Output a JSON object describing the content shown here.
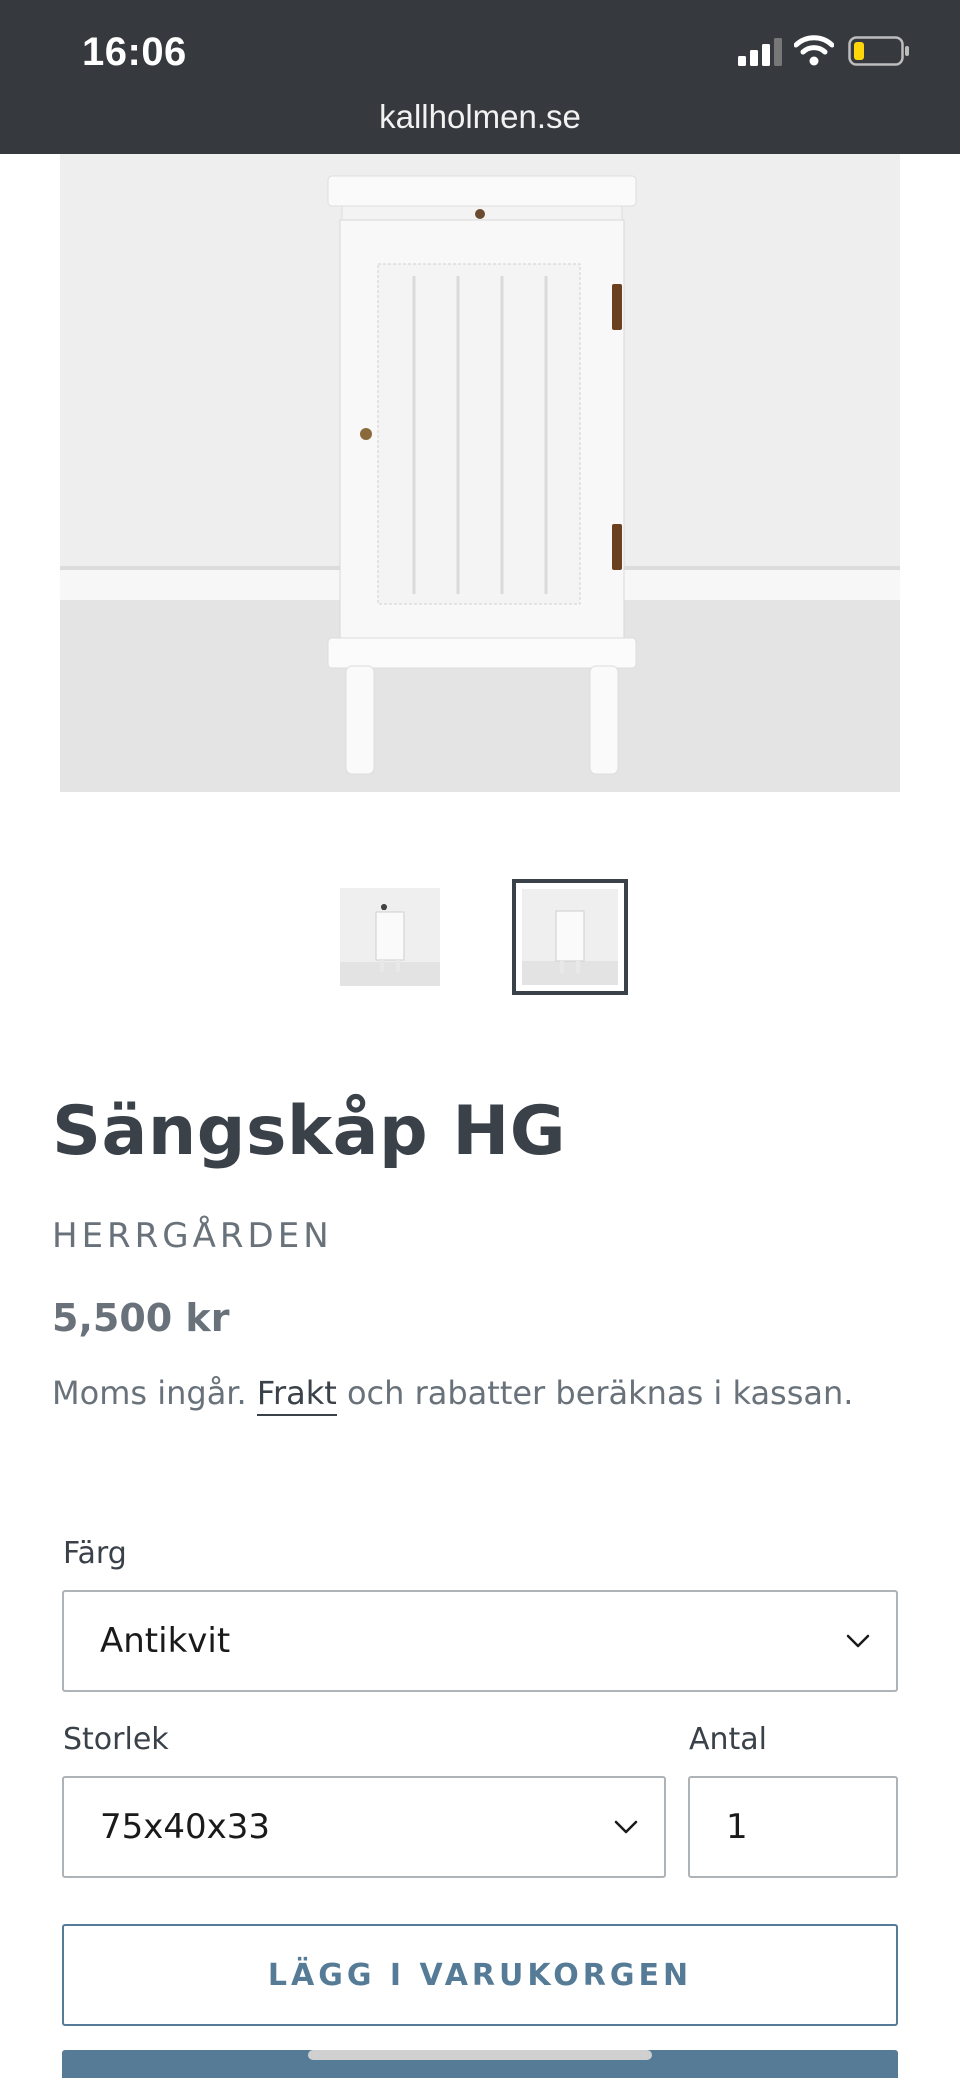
{
  "status_bar": {
    "time": "16:06"
  },
  "browser": {
    "url": "kallholmen.se"
  },
  "product": {
    "title": "Sängskåp HG",
    "vendor": "HERRGÅRDEN",
    "price": "5,500 kr",
    "tax_note_prefix": "Moms ingår.",
    "shipping_link": "Frakt",
    "tax_note_suffix": "och rabatter beräknas i kassan."
  },
  "options": {
    "color_label": "Färg",
    "color_value": "Antikvit",
    "size_label": "Storlek",
    "size_value": "75x40x33",
    "quantity_label": "Antal",
    "quantity_value": "1"
  },
  "actions": {
    "add_to_cart": "LÄGG I VARUKORGEN"
  },
  "colors": {
    "topbar": "#363a3e",
    "accent": "#557b97",
    "text": "#3a4149",
    "muted": "#69727b"
  },
  "icons": [
    "signal-icon",
    "wifi-icon",
    "battery-icon",
    "chevron-down-icon"
  ]
}
